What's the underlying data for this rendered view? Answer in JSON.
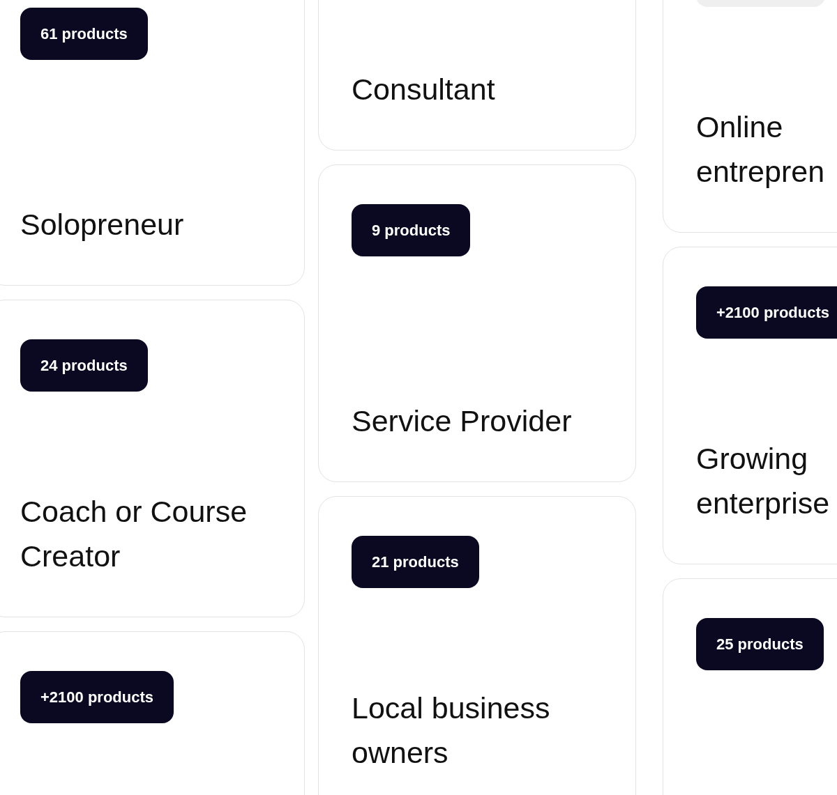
{
  "columns": [
    {
      "cards": [
        {
          "badge": {
            "kind": "count",
            "text": "61 products"
          },
          "title": [
            "Solopreneur"
          ]
        },
        {
          "badge": {
            "kind": "count",
            "text": "24 products"
          },
          "title": [
            "Coach or Course",
            "Creator"
          ]
        },
        {
          "badge": {
            "kind": "count",
            "text": "+2100 products"
          }
        }
      ]
    },
    {
      "cards": [
        {
          "title": [
            "Consultant"
          ]
        },
        {
          "badge": {
            "kind": "count",
            "text": "9 products"
          },
          "title": [
            "Service Provider"
          ]
        },
        {
          "badge": {
            "kind": "count",
            "text": "21 products"
          },
          "title": [
            "Local business",
            "owners"
          ]
        }
      ]
    },
    {
      "cards": [
        {
          "badge": {
            "kind": "blank"
          },
          "title": [
            "Online",
            "entrepren"
          ]
        },
        {
          "badge": {
            "kind": "count",
            "text": "+2100 products"
          },
          "title": [
            "Growing",
            "enterprise"
          ]
        },
        {
          "badge": {
            "kind": "count",
            "text": "25 products"
          }
        }
      ]
    }
  ]
}
